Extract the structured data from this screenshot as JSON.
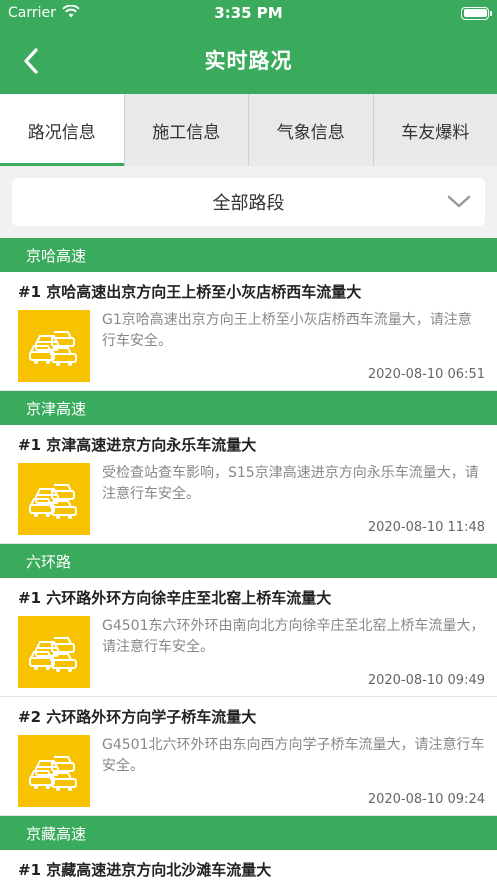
{
  "status": {
    "carrier": "Carrier",
    "time": "3:35 PM"
  },
  "nav": {
    "title": "实时路况"
  },
  "tabs": [
    {
      "label": "路况信息",
      "active": true
    },
    {
      "label": "施工信息",
      "active": false
    },
    {
      "label": "气象信息",
      "active": false
    },
    {
      "label": "车友爆料",
      "active": false
    }
  ],
  "selector": {
    "label": "全部路段"
  },
  "sections": [
    {
      "name": "京哈高速",
      "items": [
        {
          "title": "#1 京哈高速出京方向王上桥至小灰店桥西车流量大",
          "desc": "G1京哈高速出京方向王上桥至小灰店桥西车流量大，请注意行车安全。",
          "time": "2020-08-10 06:51"
        }
      ]
    },
    {
      "name": "京津高速",
      "items": [
        {
          "title": "#1 京津高速进京方向永乐车流量大",
          "desc": "受检查站查车影响，S15京津高速进京方向永乐车流量大，请注意行车安全。",
          "time": "2020-08-10 11:48"
        }
      ]
    },
    {
      "name": "六环路",
      "items": [
        {
          "title": "#1 六环路外环方向徐辛庄至北窑上桥车流量大",
          "desc": "G4501东六环外环由南向北方向徐辛庄至北窑上桥车流量大，请注意行车安全。",
          "time": "2020-08-10 09:49"
        },
        {
          "title": "#2 六环路外环方向学子桥车流量大",
          "desc": "G4501北六环外环由东向西方向学子桥车流量大，请注意行车安全。",
          "time": "2020-08-10 09:24"
        }
      ]
    },
    {
      "name": "京藏高速",
      "items": [
        {
          "title": "#1 京藏高速进京方向北沙滩车流量大",
          "desc": "",
          "time": ""
        }
      ]
    }
  ]
}
